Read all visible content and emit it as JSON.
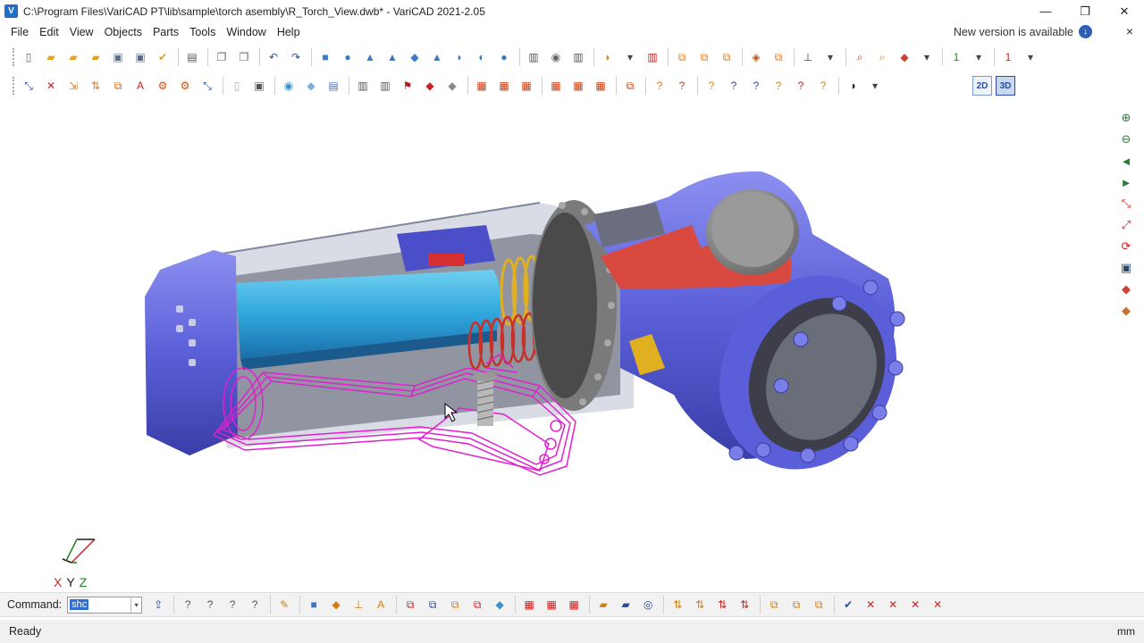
{
  "window": {
    "icon_letter": "V",
    "title": "C:\\Program Files\\VariCAD PT\\lib\\sample\\torch asembly\\R_Torch_View.dwb* - VariCAD 2021-2.05",
    "minimize": "—",
    "restore": "❐",
    "close": "✕"
  },
  "menu": {
    "items": [
      "File",
      "Edit",
      "View",
      "Objects",
      "Parts",
      "Tools",
      "Window",
      "Help"
    ],
    "notice": "New version is available",
    "notice_icon": "↓",
    "close": "×"
  },
  "toolbar1": [
    {
      "name": "new-file-icon",
      "glyph": "▯",
      "color": "#666"
    },
    {
      "name": "open-file-icon",
      "glyph": "▰",
      "color": "#e8a21a"
    },
    {
      "name": "open-recent-icon",
      "glyph": "▰",
      "color": "#e8a21a"
    },
    {
      "name": "open-folder-icon",
      "glyph": "▰",
      "color": "#e8a21a"
    },
    {
      "name": "save-icon",
      "glyph": "▣",
      "color": "#5a6a8a"
    },
    {
      "name": "save-all-icon",
      "glyph": "▣",
      "color": "#5a6a8a"
    },
    {
      "name": "save-as-icon",
      "glyph": "✔",
      "color": "#d8a020"
    },
    {
      "sep": true
    },
    {
      "name": "print-icon",
      "glyph": "▤",
      "color": "#555"
    },
    {
      "sep": true
    },
    {
      "name": "copy-icon",
      "glyph": "❐",
      "color": "#666"
    },
    {
      "name": "paste-icon",
      "glyph": "❐",
      "color": "#666"
    },
    {
      "sep": true
    },
    {
      "name": "undo-icon",
      "glyph": "↶",
      "color": "#2a4c9c"
    },
    {
      "name": "redo-icon",
      "glyph": "↷",
      "color": "#2a4c9c"
    },
    {
      "sep": true
    },
    {
      "name": "box-icon",
      "glyph": "■",
      "color": "#3a78c8"
    },
    {
      "name": "cylinder-icon",
      "glyph": "●",
      "color": "#3a78c8"
    },
    {
      "name": "cone-icon",
      "glyph": "▲",
      "color": "#3a78c8"
    },
    {
      "name": "pyramid-icon",
      "glyph": "▲",
      "color": "#3a78c8"
    },
    {
      "name": "torus-icon",
      "glyph": "◆",
      "color": "#3a78c8"
    },
    {
      "name": "prism-icon",
      "glyph": "▲",
      "color": "#3a78c8"
    },
    {
      "name": "pipe-icon",
      "glyph": "◗",
      "color": "#3a78c8"
    },
    {
      "name": "revolve-icon",
      "glyph": "◐",
      "color": "#3a78c8"
    },
    {
      "name": "sphere-icon",
      "glyph": "●",
      "color": "#3a78c8"
    },
    {
      "sep": true
    },
    {
      "name": "spring-icon",
      "glyph": "▥",
      "color": "#555"
    },
    {
      "name": "bolt-icon",
      "glyph": "◉",
      "color": "#666"
    },
    {
      "name": "thread-icon",
      "glyph": "▥",
      "color": "#555"
    },
    {
      "sep": true
    },
    {
      "name": "boolean-icon",
      "glyph": "◗",
      "color": "#d88010"
    },
    {
      "name": "dropdown-icon",
      "glyph": "▾",
      "color": "#444"
    },
    {
      "name": "cut-icon",
      "glyph": "▥",
      "color": "#c82020"
    },
    {
      "sep": true
    },
    {
      "name": "transform-icon",
      "glyph": "⧉",
      "color": "#e07a20"
    },
    {
      "name": "transform-copy-icon",
      "glyph": "⧉",
      "color": "#e07a20"
    },
    {
      "name": "transform-multi-icon",
      "glyph": "⧉",
      "color": "#e07a20"
    },
    {
      "sep": true
    },
    {
      "name": "assembly-icon",
      "glyph": "◈",
      "color": "#c05010"
    },
    {
      "name": "group-icon",
      "glyph": "⧉",
      "color": "#e07a20"
    },
    {
      "sep": true
    },
    {
      "name": "measure-icon",
      "glyph": "⊥",
      "color": "#2a4c9c"
    },
    {
      "name": "dropdown2-icon",
      "glyph": "▾",
      "color": "#444"
    },
    {
      "sep": true
    },
    {
      "name": "zoom-window-icon",
      "glyph": "⌕",
      "color": "#c83020"
    },
    {
      "name": "zoom-icon",
      "glyph": "⌕",
      "color": "#d08a10"
    },
    {
      "name": "view-cube-icon",
      "glyph": "◆",
      "color": "#d04030"
    },
    {
      "name": "dropdown3-icon",
      "glyph": "▾",
      "color": "#444"
    },
    {
      "sep": true
    },
    {
      "name": "layer-1-icon",
      "glyph": "1",
      "color": "#2a7a20"
    },
    {
      "name": "dropdown4-icon",
      "glyph": "▾",
      "color": "#444"
    },
    {
      "sep": true
    },
    {
      "name": "layer-red-icon",
      "glyph": "1",
      "color": "#c82020"
    },
    {
      "name": "dropdown5-icon",
      "glyph": "▾",
      "color": "#444"
    }
  ],
  "toolbar2": [
    {
      "name": "select-icon",
      "glyph": "⤡",
      "color": "#2a4c9c"
    },
    {
      "name": "delete-icon",
      "glyph": "✕",
      "color": "#d02020"
    },
    {
      "name": "insert-icon",
      "glyph": "⇲",
      "color": "#e07a20"
    },
    {
      "name": "explode-icon",
      "glyph": "⇅",
      "color": "#e07a20"
    },
    {
      "name": "multi-select-icon",
      "glyph": "⧉",
      "color": "#d06010"
    },
    {
      "name": "text-icon",
      "glyph": "A",
      "color": "#d02020"
    },
    {
      "name": "solid-edit-icon",
      "glyph": "⚙",
      "color": "#d05010"
    },
    {
      "name": "solid-tools-icon",
      "glyph": "⚙",
      "color": "#d05010"
    },
    {
      "name": "axis-icon",
      "glyph": "⤡",
      "color": "#2a4c9c"
    },
    {
      "sep": true
    },
    {
      "name": "wire-box-icon",
      "glyph": "▯",
      "color": "#aaa"
    },
    {
      "name": "shaded-box-icon",
      "glyph": "▣",
      "color": "#555"
    },
    {
      "sep": true
    },
    {
      "name": "color-icon",
      "glyph": "◉",
      "color": "#3a90d0"
    },
    {
      "name": "transparency-icon",
      "glyph": "◆",
      "color": "#7ab0e0"
    },
    {
      "name": "layers-icon",
      "glyph": "▤",
      "color": "#4a70b0"
    },
    {
      "sep": true
    },
    {
      "name": "section-icon",
      "glyph": "▥",
      "color": "#555"
    },
    {
      "name": "section2-icon",
      "glyph": "▥",
      "color": "#555"
    },
    {
      "name": "attribute-icon",
      "glyph": "⚑",
      "color": "#b02020"
    },
    {
      "name": "material-icon",
      "glyph": "◆",
      "color": "#d02020"
    },
    {
      "name": "mass-icon",
      "glyph": "◆",
      "color": "#888"
    },
    {
      "sep": true
    },
    {
      "name": "bom-icon",
      "glyph": "▦",
      "color": "#d04010"
    },
    {
      "name": "bom2-icon",
      "glyph": "▦",
      "color": "#d04010"
    },
    {
      "name": "bom3-icon",
      "glyph": "▦",
      "color": "#d04010"
    },
    {
      "sep": true
    },
    {
      "name": "parts-icon",
      "glyph": "▦",
      "color": "#d04010"
    },
    {
      "name": "parts2-icon",
      "glyph": "▦",
      "color": "#d04010"
    },
    {
      "name": "parts3-icon",
      "glyph": "▦",
      "color": "#d04010"
    },
    {
      "sep": true
    },
    {
      "name": "copy-parts-icon",
      "glyph": "⧉",
      "color": "#d04010"
    },
    {
      "sep": true
    },
    {
      "name": "query-icon",
      "glyph": "?",
      "color": "#e07a20"
    },
    {
      "name": "query2-icon",
      "glyph": "?",
      "color": "#c04010"
    },
    {
      "sep": true
    },
    {
      "name": "check-icon",
      "glyph": "?",
      "color": "#d08a10"
    },
    {
      "name": "check2-icon",
      "glyph": "?",
      "color": "#2a4c9c"
    },
    {
      "name": "check3-icon",
      "glyph": "?",
      "color": "#2a4c9c"
    },
    {
      "name": "check4-icon",
      "glyph": "?",
      "color": "#d08a10"
    },
    {
      "name": "check5-icon",
      "glyph": "?",
      "color": "#d02020"
    },
    {
      "name": "check6-icon",
      "glyph": "?",
      "color": "#d08a10"
    },
    {
      "sep": true
    },
    {
      "name": "center-of-gravity-icon",
      "glyph": "◑",
      "color": "#222"
    },
    {
      "name": "dropdown6-icon",
      "glyph": "▾",
      "color": "#444"
    }
  ],
  "view_switch": {
    "two_d": "2D",
    "three_d": "3D"
  },
  "right_tools": [
    {
      "name": "zoom-all-icon",
      "glyph": "⊕",
      "color": "#2a7a3a"
    },
    {
      "name": "zoom-out-icon",
      "glyph": "⊖",
      "color": "#2a7a3a"
    },
    {
      "name": "zoom-previous-icon",
      "glyph": "◄",
      "color": "#2a7a3a"
    },
    {
      "name": "zoom-next-icon",
      "glyph": "►",
      "color": "#2a7a3a"
    },
    {
      "name": "view-axis-icon",
      "glyph": "⤡",
      "color": "#d02020"
    },
    {
      "name": "view-frame-icon",
      "glyph": "⤢",
      "color": "#d02020"
    },
    {
      "name": "rotate-view-icon",
      "glyph": "⟳",
      "color": "#d02020"
    },
    {
      "name": "view-box-icon",
      "glyph": "▣",
      "color": "#2a4c6c"
    },
    {
      "name": "render-icon",
      "glyph": "◆",
      "color": "#d04030"
    },
    {
      "name": "render2-icon",
      "glyph": "◆",
      "color": "#d07030"
    }
  ],
  "axis_labels": [
    "X",
    "Y",
    "Z"
  ],
  "command": {
    "label": "Command:",
    "value": "shc",
    "dropdown": "▾"
  },
  "cmd_icons": [
    {
      "name": "export-icon",
      "glyph": "⇪",
      "color": "#2a4c9c"
    },
    {
      "sep": true
    },
    {
      "name": "query-a-icon",
      "glyph": "?",
      "color": "#555"
    },
    {
      "name": "query-b-icon",
      "glyph": "?",
      "color": "#555"
    },
    {
      "name": "query-c-icon",
      "glyph": "?",
      "color": "#555"
    },
    {
      "name": "query-d-icon",
      "glyph": "?",
      "color": "#555"
    },
    {
      "sep": true
    },
    {
      "name": "pencil-icon",
      "glyph": "✎",
      "color": "#d08010"
    },
    {
      "sep": true
    },
    {
      "name": "solid-a-icon",
      "glyph": "■",
      "color": "#3a78c8"
    },
    {
      "name": "solid-b-icon",
      "glyph": "◆",
      "color": "#d08010"
    },
    {
      "name": "solid-c-icon",
      "glyph": "⊥",
      "color": "#d08010"
    },
    {
      "name": "text-style-icon",
      "glyph": "A",
      "color": "#d08010"
    },
    {
      "sep": true
    },
    {
      "name": "edit-a-icon",
      "glyph": "⧉",
      "color": "#d02020"
    },
    {
      "name": "edit-b-icon",
      "glyph": "⧉",
      "color": "#2a4c9c"
    },
    {
      "name": "edit-c-icon",
      "glyph": "⧉",
      "color": "#d08010"
    },
    {
      "name": "edit-d-icon",
      "glyph": "⧉",
      "color": "#d02020"
    },
    {
      "name": "drop-icon",
      "glyph": "◆",
      "color": "#3a90d0"
    },
    {
      "sep": true
    },
    {
      "name": "table-a-icon",
      "glyph": "▦",
      "color": "#d02020"
    },
    {
      "name": "table-b-icon",
      "glyph": "▦",
      "color": "#d02020"
    },
    {
      "name": "table-c-icon",
      "glyph": "▦",
      "color": "#d02020"
    },
    {
      "sep": true
    },
    {
      "name": "folder-a-icon",
      "glyph": "▰",
      "color": "#d08010"
    },
    {
      "name": "folder-b-icon",
      "glyph": "▰",
      "color": "#2a4c9c"
    },
    {
      "name": "target-icon",
      "glyph": "◎",
      "color": "#2a4c9c"
    },
    {
      "sep": true
    },
    {
      "name": "move-a-icon",
      "glyph": "⇅",
      "color": "#d08010"
    },
    {
      "name": "move-b-icon",
      "glyph": "⇅",
      "color": "#d08010"
    },
    {
      "name": "move-c-icon",
      "glyph": "⇅",
      "color": "#d02020"
    },
    {
      "name": "move-d-icon",
      "glyph": "⇅",
      "color": "#d02020"
    },
    {
      "sep": true
    },
    {
      "name": "group-a-icon",
      "glyph": "⧉",
      "color": "#d08010"
    },
    {
      "name": "group-b-icon",
      "glyph": "⧉",
      "color": "#d08010"
    },
    {
      "name": "group-c-icon",
      "glyph": "⧉",
      "color": "#d08010"
    },
    {
      "sep": true
    },
    {
      "name": "check-a-icon",
      "glyph": "✔",
      "color": "#2a4c9c"
    },
    {
      "name": "cancel-a-icon",
      "glyph": "✕",
      "color": "#d02020"
    },
    {
      "name": "cancel-b-icon",
      "glyph": "✕",
      "color": "#d02020"
    },
    {
      "name": "cancel-c-icon",
      "glyph": "✕",
      "color": "#d02020"
    },
    {
      "name": "cancel-d-icon",
      "glyph": "✕",
      "color": "#d02020"
    }
  ],
  "status": {
    "text": "Ready",
    "units": "mm"
  }
}
